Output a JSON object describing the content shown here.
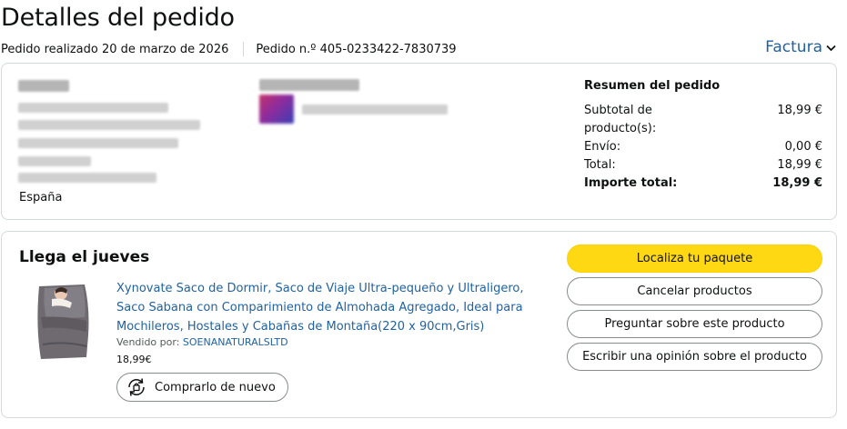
{
  "page": {
    "title": "Detalles del pedido",
    "order_date": "Pedido realizado 20 de marzo de 2026",
    "order_number": "Pedido n.º 405-0233422-7830739",
    "invoice_label": "Factura"
  },
  "address": {
    "country": "España"
  },
  "summary": {
    "title": "Resumen del pedido",
    "rows": [
      {
        "label": "Subtotal de producto(s):",
        "value": "18,99 €"
      },
      {
        "label": "Envío:",
        "value": "0,00 €"
      },
      {
        "label": "Total:",
        "value": "18,99 €"
      },
      {
        "label": "Importe total:",
        "value": "18,99 €"
      }
    ]
  },
  "shipment": {
    "status": "Llega el jueves",
    "product_title": "Xynovate Saco de Dormir, Saco de Viaje Ultra-pequeño y Ultraligero, Saco Sabana con Comparimiento de Almohada Agregado, Ideal para Mochileros, Hostales y Cabañas de Montaña(220 x 90cm,Gris)",
    "sold_by_label": "Vendido por:",
    "seller": "SOENANATURALSLTD",
    "price": "18,99€",
    "buy_again_label": "Comprarlo de nuevo"
  },
  "actions": {
    "track": "Localiza tu paquete",
    "cancel": "Cancelar productos",
    "ask": "Preguntar sobre este producto",
    "review": "Escribir una opinión sobre el producto"
  },
  "colors": {
    "link": "#2162a1",
    "primary_button": "#ffd814",
    "border": "#d5d9d9"
  }
}
